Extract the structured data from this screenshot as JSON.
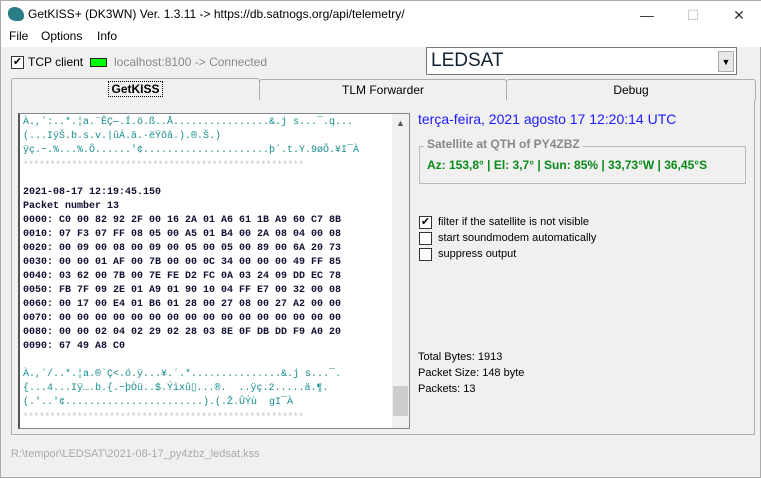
{
  "window": {
    "title": "GetKISS+ (DK3WN) Ver. 1.3.11 -> https://db.satnogs.org/api/telemetry/",
    "minimize": "—",
    "maximize": "☐",
    "close": "✕"
  },
  "menu": [
    "File",
    "Options",
    "Info"
  ],
  "toolbar": {
    "tcp_label": "TCP client",
    "tcp_checked": "✔",
    "connection": "localhost:8100 -> Connected",
    "led_color": "#00ff00",
    "satellite": "LEDSAT",
    "dropdown_arrow": "▼"
  },
  "tabs": [
    "GetKISS",
    "TLM Forwarder",
    "Debug"
  ],
  "log": {
    "ascii_prev": [
      "À.,ʼ:..*.¦a.¨ÊÇ—.Í.ö.ß..Å................&.j s...¯.q...",
      "(...IÿŠ.b.s.v.|ûÁ.ä.·ëŸôâ.).®.Š.)",
      "ÿç.−.%...%.Ô......'¢.....................þ`.t.Y.9øÕ.¥I¯À"
    ],
    "separator": "****************************************************",
    "timestamp": "2021-08-17 12:19:45.150",
    "packet": "Packet number 13",
    "hex": [
      "0000: C0 00 82 92 2F 00 16 2A 01 A6 61 1B A9 60 C7 8B",
      "0010: 07 F3 07 FF 08 05 00 A5 01 B4 00 2A 08 04 00 08",
      "0020: 00 09 00 08 00 09 00 05 00 05 00 89 00 6A 20 73",
      "0030: 00 00 01 AF 00 7B 00 00 0C 34 00 00 00 49 FF 85",
      "0040: 03 62 00 7B 00 7E FE D2 FC 0A 03 24 09 DD EC 78",
      "0050: FB 7F 09 2E 01 A9 01 90 10 04 FF E7 00 32 00 08",
      "0060: 00 17 00 E4 01 B6 01 28 00 27 08 00 27 A2 00 00",
      "0070: 00 00 00 00 00 00 00 00 00 00 00 00 00 00 00 00",
      "0080: 00 00 02 04 02 29 02 28 03 8E 0F DB DD F9 A0 20",
      "0090: 67 49 A8 C0"
    ],
    "ascii": [
      "À.,ʼ/..*.¦a.®`Ç<.ó.ÿ...¥.´.*...............&.j s...¯.",
      "{...4...Iÿ….b.{.~þÒü..$.Ýìxû▯...®.  ..ÿç.2.....ä.¶.",
      "(.'..'¢.......................).(.Ž.ÛÝù  gI¯À"
    ]
  },
  "info": {
    "datetime": "terça-feira, 2021 agosto 17  12:20:14 UTC",
    "group_title": "Satellite at QTH of PY4ZBZ",
    "position": "Az: 153,8° | El: 3,7° | Sun: 85% | 33,73°W | 36,45°S",
    "options": [
      {
        "label": "filter if the satellite is not visible",
        "checked": "✔"
      },
      {
        "label": "start soundmodem automatically",
        "checked": ""
      },
      {
        "label": "suppress output",
        "checked": ""
      }
    ],
    "total_bytes": "Total Bytes: 1913",
    "packet_size": "Packet Size: 148 byte",
    "packets": "Packets: 13"
  },
  "status": "R:\\tempor\\LEDSAT\\2021-08-17_py4zbz_ledsat.kss"
}
